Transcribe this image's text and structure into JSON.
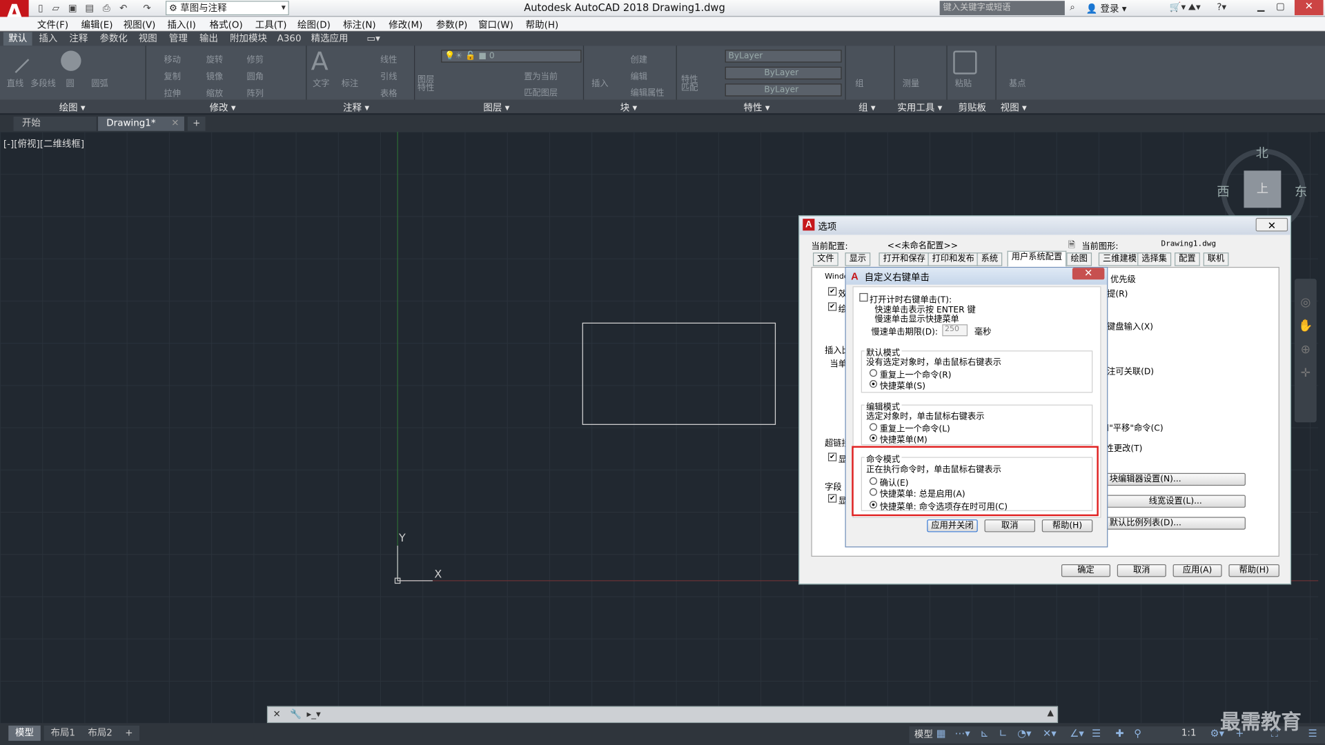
{
  "titlebar": {
    "workspace": "草图与注释",
    "title": "Autodesk AutoCAD 2018    Drawing1.dwg",
    "search_placeholder": "键入关键字或短语",
    "login": "登录",
    "help": "?"
  },
  "menu": [
    "文件(F)",
    "编辑(E)",
    "视图(V)",
    "插入(I)",
    "格式(O)",
    "工具(T)",
    "绘图(D)",
    "标注(N)",
    "修改(M)",
    "参数(P)",
    "窗口(W)",
    "帮助(H)"
  ],
  "ribbon_tabs": [
    "默认",
    "插入",
    "注释",
    "参数化",
    "视图",
    "管理",
    "输出",
    "附加模块",
    "A360",
    "精选应用"
  ],
  "ribbon": {
    "draw": [
      "直线",
      "多段线",
      "圆",
      "圆弧"
    ],
    "modify": [
      "移动",
      "旋转",
      "修剪",
      "复制",
      "镜像",
      "圆角",
      "拉伸",
      "缩放",
      "阵列"
    ],
    "annotation": [
      "文字",
      "标注",
      "线性",
      "引线",
      "表格"
    ],
    "layers": [
      "图层特性",
      "0",
      "置为当前",
      "匹配图层"
    ],
    "block": [
      "插入",
      "创建",
      "编辑",
      "编辑属性"
    ],
    "props": [
      "特性匹配",
      "ByLayer",
      "ByLayer",
      "ByLayer"
    ],
    "groups": [
      "组"
    ],
    "utils": [
      "测量"
    ],
    "clip": [
      "粘贴"
    ],
    "view": [
      "基点"
    ],
    "panels": [
      "绘图 ▾",
      "修改 ▾",
      "注释 ▾",
      "图层 ▾",
      "块 ▾",
      "特性 ▾",
      "组 ▾",
      "实用工具 ▾",
      "剪贴板",
      "视图 ▾"
    ]
  },
  "doc_tabs": [
    "开始",
    "Drawing1*"
  ],
  "viewport_label": "[-][俯视][二维线框]",
  "compass": {
    "north": "北",
    "south": "南",
    "east": "东",
    "west": "西",
    "top": "上"
  },
  "ucs": {
    "x": "X",
    "y": "Y"
  },
  "options": {
    "title": "选项",
    "current_profile_label": "当前配置:",
    "current_profile": "<<未命名配置>>",
    "current_drawing_label": "当前图形:",
    "current_drawing": "Drawing1.dwg",
    "tabs": [
      "文件",
      "显示",
      "打开和保存",
      "打印和发布",
      "系统",
      "用户系统配置",
      "绘图",
      "三维建模",
      "选择集",
      "配置",
      "联机"
    ],
    "left": [
      "Windo",
      "效",
      "绘",
      "插入比",
      "当单",
      "超链接",
      "显",
      "字段",
      "显"
    ],
    "right": [
      "优先级",
      "提(R)",
      "键盘输入(X)",
      "注可关联(D)",
      "\"和\"平移\"命令(C)",
      "性更改(T)"
    ],
    "right_buttons": [
      "块编辑器设置(N)...",
      "线宽设置(L)...",
      "默认比例列表(D)..."
    ],
    "buttons": [
      "确定",
      "取消",
      "应用(A)",
      "帮助(H)"
    ]
  },
  "rightclick": {
    "title": "自定义右键单击",
    "timer_label": "打开计时右键单击(T):",
    "timer_desc1": "快速单击表示按 ENTER 键",
    "timer_desc2": "慢速单击显示快捷菜单",
    "long_label": "慢速单击期限(D):",
    "long_value": "250",
    "ms": "毫秒",
    "default_title": "默认模式",
    "default_desc": "没有选定对象时，单击鼠标右键表示",
    "default_opts": [
      "重复上一个命令(R)",
      "快捷菜单(S)"
    ],
    "edit_title": "编辑模式",
    "edit_desc": "选定对象时，单击鼠标右键表示",
    "edit_opts": [
      "重复上一个命令(L)",
      "快捷菜单(M)"
    ],
    "cmd_title": "命令模式",
    "cmd_desc": "正在执行命令时，单击鼠标右键表示",
    "cmd_opts": [
      "确认(E)",
      "快捷菜单: 总是启用(A)",
      "快捷菜单: 命令选项存在时可用(C)"
    ],
    "buttons": [
      "应用并关闭",
      "取消",
      "帮助(H)"
    ]
  },
  "layouts": [
    "模型",
    "布局1",
    "布局2"
  ],
  "status": {
    "model": "模型",
    "scale": "1:1"
  },
  "watermark": "最需教育"
}
